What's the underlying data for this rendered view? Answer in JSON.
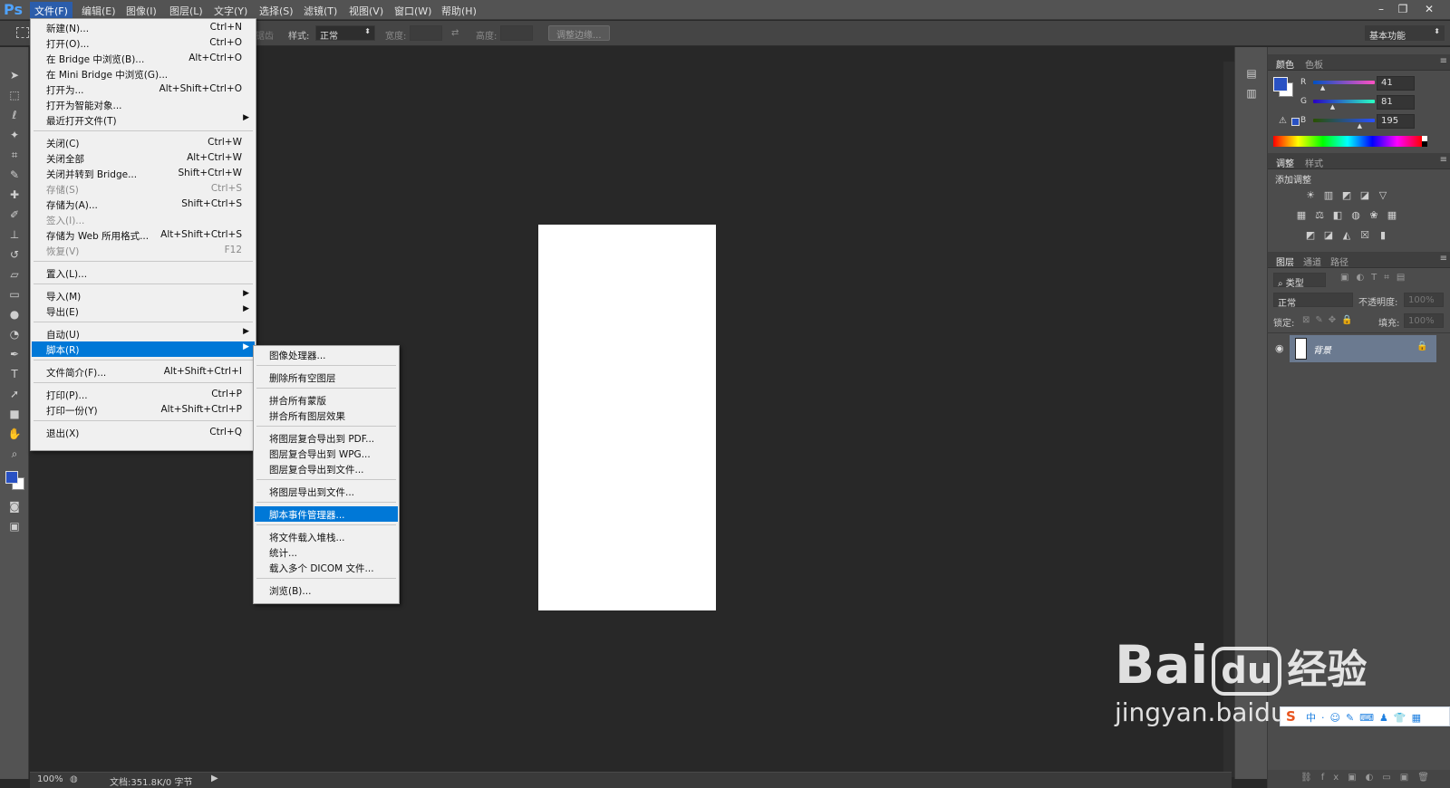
{
  "app": {
    "logo": "Ps"
  },
  "menubar": {
    "items": [
      "文件(F)",
      "编辑(E)",
      "图像(I)",
      "图层(L)",
      "文字(Y)",
      "选择(S)",
      "滤镜(T)",
      "视图(V)",
      "窗口(W)",
      "帮助(H)"
    ],
    "window_controls": [
      "minimize-icon",
      "restore-icon",
      "close-icon"
    ]
  },
  "options": {
    "feather_suffix": "锯齿",
    "style_label": "样式:",
    "style_value": "正常",
    "width_label": "宽度:",
    "height_label": "高度:",
    "refine_edge": "调整边缘...",
    "workspace": "基本功能"
  },
  "file_menu": {
    "items": [
      {
        "label": "新建(N)...",
        "shortcut": "Ctrl+N"
      },
      {
        "label": "打开(O)...",
        "shortcut": "Ctrl+O"
      },
      {
        "label": "在 Bridge 中浏览(B)...",
        "shortcut": "Alt+Ctrl+O"
      },
      {
        "label": "在 Mini Bridge 中浏览(G)...",
        "shortcut": ""
      },
      {
        "label": "打开为...",
        "shortcut": "Alt+Shift+Ctrl+O"
      },
      {
        "label": "打开为智能对象...",
        "shortcut": ""
      },
      {
        "label": "最近打开文件(T)",
        "shortcut": ""
      },
      {
        "label": "关闭(C)",
        "shortcut": "Ctrl+W"
      },
      {
        "label": "关闭全部",
        "shortcut": "Alt+Ctrl+W"
      },
      {
        "label": "关闭并转到 Bridge...",
        "shortcut": "Shift+Ctrl+W"
      },
      {
        "label": "存储(S)",
        "shortcut": "Ctrl+S"
      },
      {
        "label": "存储为(A)...",
        "shortcut": "Shift+Ctrl+S"
      },
      {
        "label": "签入(I)...",
        "shortcut": ""
      },
      {
        "label": "存储为 Web 所用格式...",
        "shortcut": "Alt+Shift+Ctrl+S"
      },
      {
        "label": "恢复(V)",
        "shortcut": "F12"
      },
      {
        "label": "置入(L)...",
        "shortcut": ""
      },
      {
        "label": "导入(M)",
        "shortcut": ""
      },
      {
        "label": "导出(E)",
        "shortcut": ""
      },
      {
        "label": "自动(U)",
        "shortcut": ""
      },
      {
        "label": "脚本(R)",
        "shortcut": ""
      },
      {
        "label": "文件简介(F)...",
        "shortcut": "Alt+Shift+Ctrl+I"
      },
      {
        "label": "打印(P)...",
        "shortcut": "Ctrl+P"
      },
      {
        "label": "打印一份(Y)",
        "shortcut": "Alt+Shift+Ctrl+P"
      },
      {
        "label": "退出(X)",
        "shortcut": "Ctrl+Q"
      }
    ]
  },
  "script_menu": {
    "items": [
      "图像处理器...",
      "删除所有空图层",
      "拼合所有蒙版",
      "拼合所有图层效果",
      "将图层复合导出到 PDF...",
      "图层复合导出到 WPG...",
      "图层复合导出到文件...",
      "将图层导出到文件...",
      "脚本事件管理器...",
      "将文件载入堆栈...",
      "统计...",
      "载入多个 DICOM 文件...",
      "浏览(B)..."
    ]
  },
  "color_panel": {
    "tabs": [
      "颜色",
      "色板"
    ],
    "r_label": "R",
    "g_label": "G",
    "b_label": "B",
    "r": "41",
    "g": "81",
    "b": "195",
    "r_fraction": 0.16,
    "g_fraction": 0.32,
    "b_fraction": 0.76,
    "foreground": "#2951c3",
    "background": "#ffffff"
  },
  "adjust_panel": {
    "tabs": [
      "调整",
      "样式"
    ],
    "title": "添加调整"
  },
  "layers_panel": {
    "tabs": [
      "图层",
      "通道",
      "路径"
    ],
    "filter_label": "类型",
    "blend_mode": "正常",
    "opacity_label": "不透明度:",
    "opacity_value": "100%",
    "lock_label": "锁定:",
    "fill_label": "填充:",
    "fill_value": "100%",
    "layers": [
      {
        "name": "背景"
      }
    ]
  },
  "status": {
    "zoom": "100%",
    "doc_info": "文档:351.8K/0 字节"
  },
  "watermark": {
    "brand": "Bai",
    "paw": "du",
    "jingyan": "经验",
    "url": "jingyan.baidu.com"
  }
}
